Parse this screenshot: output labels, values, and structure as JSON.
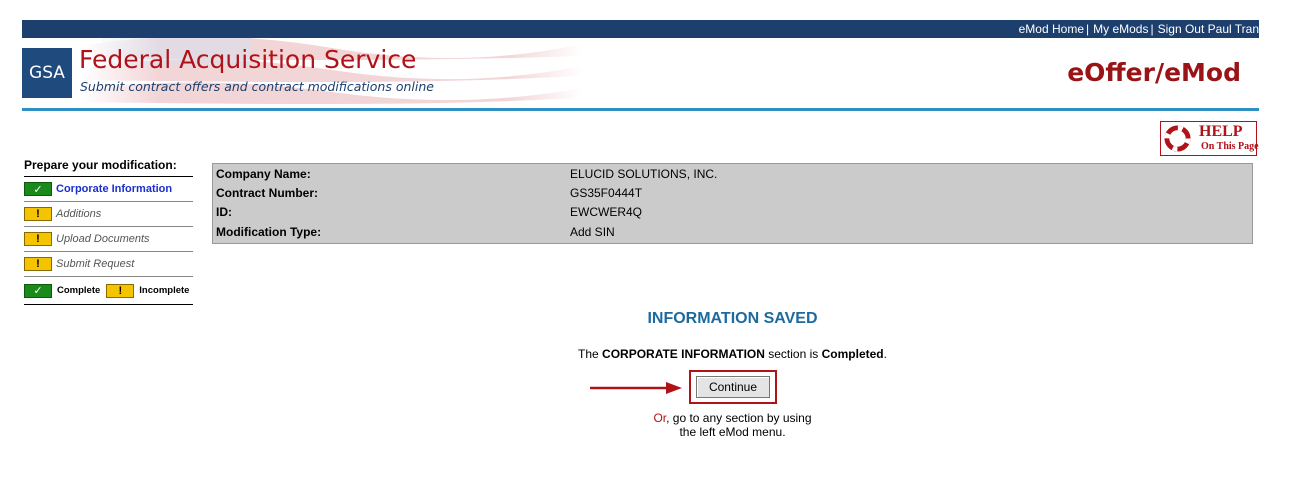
{
  "top_nav": {
    "links": [
      "eMod Home",
      "My eMods",
      "Sign Out Paul Tran"
    ]
  },
  "header": {
    "logo_text": "GSA",
    "title": "Federal Acquisition Service",
    "subtitle": "Submit contract offers and contract modifications online",
    "app_name": "eOffer/eMod"
  },
  "help": {
    "big": "HELP",
    "small": "On This Page"
  },
  "sidebar": {
    "title": "Prepare your modification:",
    "items": [
      {
        "label": "Corporate Information",
        "status": "complete",
        "mark": "✓"
      },
      {
        "label": "Additions",
        "status": "incomplete",
        "mark": "!"
      },
      {
        "label": "Upload Documents",
        "status": "incomplete",
        "mark": "!"
      },
      {
        "label": "Submit Request",
        "status": "incomplete",
        "mark": "!"
      }
    ],
    "legend": {
      "complete_mark": "✓",
      "complete_label": "Complete",
      "incomplete_mark": "!",
      "incomplete_label": "Incomplete"
    }
  },
  "contract_info": [
    {
      "label": "Company Name:",
      "value": "ELUCID SOLUTIONS, INC."
    },
    {
      "label": "Contract Number:",
      "value": "GS35F0444T"
    },
    {
      "label": "ID:",
      "value": "EWCWER4Q"
    },
    {
      "label": "Modification Type:",
      "value": "Add SIN"
    }
  ],
  "status": {
    "title": "INFORMATION SAVED",
    "msg_prefix": "The ",
    "msg_section": "CORPORATE INFORMATION",
    "msg_middle": " section is ",
    "msg_state": "Completed",
    "msg_end": ".",
    "continue_label": "Continue",
    "or_word": "Or",
    "or_rest_1": ", go to any section by using",
    "or_rest_2": "the left eMod menu."
  },
  "colors": {
    "navy": "#1c3f6e",
    "brand_red": "#b01218",
    "accent_blue": "#2d8fc2",
    "complete_green": "#1a8a1a",
    "incomplete_yellow": "#f5c400"
  }
}
